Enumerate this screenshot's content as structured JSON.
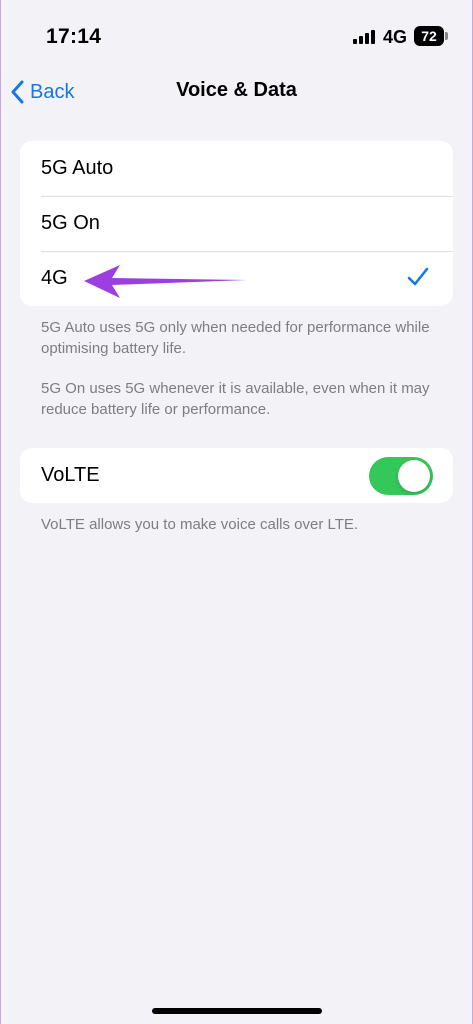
{
  "status_bar": {
    "time": "17:14",
    "network": "4G",
    "battery": "72"
  },
  "nav": {
    "back_label": "Back",
    "title": "Voice & Data"
  },
  "options": {
    "items": [
      {
        "label": "5G Auto",
        "selected": false
      },
      {
        "label": "5G On",
        "selected": false
      },
      {
        "label": "4G",
        "selected": true
      }
    ],
    "footer_1": "5G Auto uses 5G only when needed for performance while optimising battery life.",
    "footer_2": "5G On uses 5G whenever it is available, even when it may reduce battery life or performance."
  },
  "volte": {
    "label": "VoLTE",
    "enabled": true,
    "footer": "VoLTE allows you to make voice calls over LTE."
  },
  "colors": {
    "accent": "#1677e5",
    "toggle_on": "#34c759",
    "annotation_arrow": "#9b3fe0",
    "background": "#f2f2f7"
  },
  "icons": {
    "back": "chevron-left-icon",
    "checkmark": "checkmark-icon",
    "annotation": "arrow-left-icon"
  }
}
